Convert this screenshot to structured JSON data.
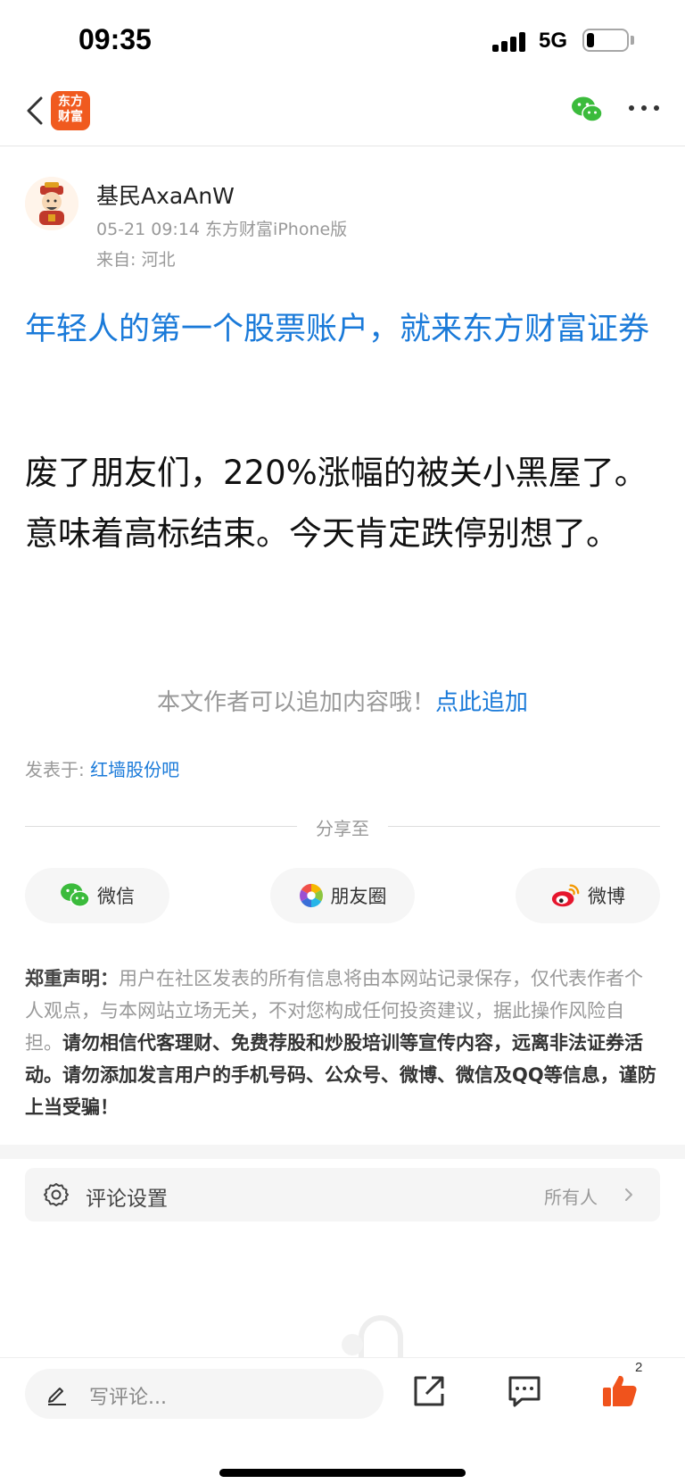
{
  "status_bar": {
    "time": "09:35",
    "network": "5G"
  },
  "nav": {
    "logo_text": "东方财富",
    "wechat_icon": "wechat-icon",
    "more_icon": "more-dots-icon",
    "back_icon": "chevron-left-icon"
  },
  "author": {
    "name": "基民AxaAnW",
    "meta": "05-21 09:14 东方财富iPhone版",
    "location": "来自: 河北"
  },
  "ad_title": "年轻人的第一个股票账户，就来东方财富证券",
  "post_body": "废了朋友们，220%涨幅的被关小黑屋了。意味着高标结束。今天肯定跌停别想了。",
  "append": {
    "text": "本文作者可以追加内容哦！",
    "link": "点此追加"
  },
  "posted_in": {
    "label": "发表于:",
    "bar_name": "红墙股份吧"
  },
  "share": {
    "title": "分享至",
    "buttons": [
      {
        "label": "微信",
        "icon": "wechat-icon"
      },
      {
        "label": "朋友圈",
        "icon": "moments-icon"
      },
      {
        "label": "微博",
        "icon": "weibo-icon"
      }
    ]
  },
  "disclaimer": {
    "heading": "郑重声明：",
    "normal": "用户在社区发表的所有信息将由本网站记录保存，仅代表作者个人观点，与本网站立场无关，不对您构成任何投资建议，据此操作风险自担。",
    "bold": "请勿相信代客理财、免费荐股和炒股培训等宣传内容，远离非法证券活动。请勿添加发言用户的手机号码、公众号、微博、微信及QQ等信息，谨防上当受骗！"
  },
  "comment_settings": {
    "label": "评论设置",
    "value": "所有人",
    "icon": "gear-icon"
  },
  "bottom_bar": {
    "comment_placeholder": "写评论...",
    "share_icon": "share-external-icon",
    "comment_icon": "comment-icon",
    "like_icon": "thumbs-up-icon",
    "like_count": "2"
  },
  "colors": {
    "accent_blue": "#1a7ad9",
    "brand_orange": "#f05a1f",
    "like_orange": "#f0531c"
  }
}
